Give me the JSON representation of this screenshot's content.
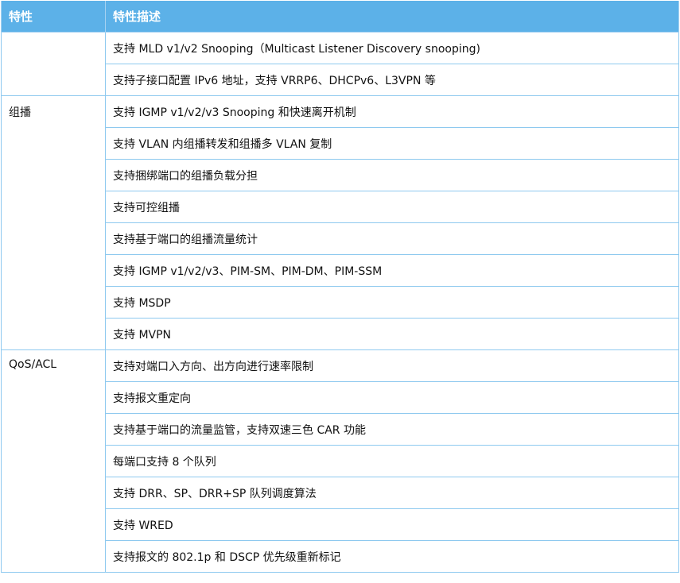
{
  "headers": {
    "feature": "特性",
    "description": "特性描述"
  },
  "groups": [
    {
      "feature": "",
      "items": [
        "支持 MLD v1/v2 Snooping（Multicast Listener Discovery snooping)",
        "支持子接口配置 IPv6 地址，支持 VRRP6、DHCPv6、L3VPN 等"
      ]
    },
    {
      "feature": "组播",
      "items": [
        "支持 IGMP v1/v2/v3 Snooping 和快速离开机制",
        "支持 VLAN 内组播转发和组播多 VLAN 复制",
        "支持捆绑端口的组播负载分担",
        "支持可控组播",
        "支持基于端口的组播流量统计",
        "支持 IGMP v1/v2/v3、PIM-SM、PIM-DM、PIM-SSM",
        "支持 MSDP",
        "支持 MVPN"
      ]
    },
    {
      "feature": "QoS/ACL",
      "items": [
        "支持对端口入方向、出方向进行速率限制",
        "支持报文重定向",
        "支持基于端口的流量监管，支持双速三色 CAR 功能",
        "每端口支持 8 个队列",
        "支持 DRR、SP、DRR+SP 队列调度算法",
        "支持 WRED",
        "支持报文的 802.1p 和 DSCP 优先级重新标记"
      ]
    }
  ]
}
